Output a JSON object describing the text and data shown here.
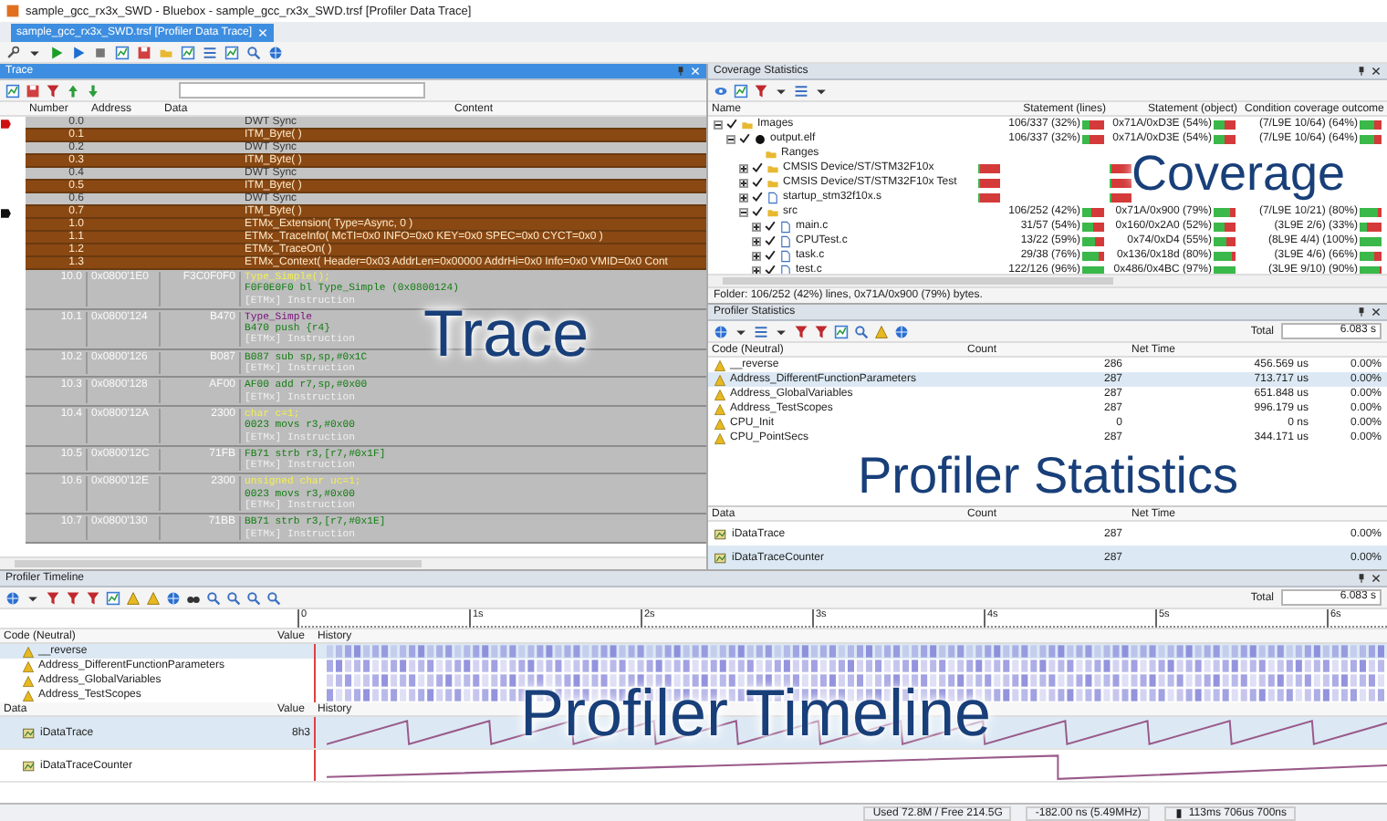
{
  "window": {
    "title": "sample_gcc_rx3x_SWD - Bluebox - sample_gcc_rx3x_SWD.trsf [Profiler Data Trace]"
  },
  "doc_tabs": [
    {
      "label": "sample_gcc_rx3x_SWD.trsf [Profiler Data Trace]",
      "selected": true
    }
  ],
  "trace": {
    "title": "Trace",
    "overlay": "Trace",
    "columns": [
      "Number",
      "Address",
      "Data",
      "Content"
    ],
    "header_rows": [
      {
        "number": "0.0",
        "content": "DWT Sync",
        "kind": "sync",
        "trigger": true,
        "cursor": false
      },
      {
        "number": "0.1",
        "content": "ITM_Byte( )",
        "kind": "event",
        "trigger": false,
        "cursor": false
      },
      {
        "number": "0.2",
        "content": "DWT Sync",
        "kind": "sync",
        "trigger": false,
        "cursor": false
      },
      {
        "number": "0.3",
        "content": "ITM_Byte( )",
        "kind": "event",
        "trigger": false,
        "cursor": false
      },
      {
        "number": "0.4",
        "content": "DWT Sync",
        "kind": "sync",
        "trigger": false,
        "cursor": false
      },
      {
        "number": "0.5",
        "content": "ITM_Byte( )",
        "kind": "event",
        "trigger": false,
        "cursor": false
      },
      {
        "number": "0.6",
        "content": "DWT Sync",
        "kind": "sync",
        "trigger": false,
        "cursor": false
      },
      {
        "number": "0.7",
        "content": "ITM_Byte( )",
        "kind": "event",
        "trigger": false,
        "cursor": true
      },
      {
        "number": "1.0",
        "content": "ETMx_Extension( Type=Async, 0 )",
        "kind": "event",
        "trigger": false,
        "cursor": false
      },
      {
        "number": "1.1",
        "content": "ETMx_TraceInfo( McTI=0x0 INFO=0x0 KEY=0x0 SPEC=0x0 CYCT=0x0 )",
        "kind": "event",
        "trigger": false,
        "cursor": false
      },
      {
        "number": "1.2",
        "content": "ETMx_TraceOn( )",
        "kind": "event",
        "trigger": false,
        "cursor": false
      },
      {
        "number": "1.3",
        "content": "ETMx_Context( Header=0x03 AddrLen=0x00000 AddrHi=0x0 Info=0x0 VMID=0x0 Cont",
        "kind": "event",
        "trigger": false,
        "cursor": false
      }
    ],
    "instruction_rows": [
      {
        "number": "10.0",
        "address": "0x0800'1E0",
        "data": "F3C0F0F0",
        "lines": [
          {
            "kind": "source",
            "text": "Type_Simple();"
          },
          {
            "kind": "asm",
            "text": "F0F0E0F0 bl          Type_Simple (0x0800124)"
          },
          {
            "kind": "note",
            "text": "[ETMx] Instruction"
          }
        ]
      },
      {
        "number": "10.1",
        "address": "0x0800'124",
        "data": "B470",
        "lines": [
          {
            "kind": "label",
            "text": "Type_Simple"
          },
          {
            "kind": "asm",
            "text": "B470 push    {r4}"
          },
          {
            "kind": "note",
            "text": "[ETMx] Instruction"
          }
        ]
      },
      {
        "number": "10.2",
        "address": "0x0800'126",
        "data": "B087",
        "lines": [
          {
            "kind": "asm",
            "text": "B087 sub     sp,sp,#0x1C"
          },
          {
            "kind": "note",
            "text": "[ETMx] Instruction"
          }
        ]
      },
      {
        "number": "10.3",
        "address": "0x0800'128",
        "data": "AF00",
        "lines": [
          {
            "kind": "asm",
            "text": "AF00 add     r7,sp,#0x00"
          },
          {
            "kind": "note",
            "text": "[ETMx] Instruction"
          }
        ]
      },
      {
        "number": "10.4",
        "address": "0x0800'12A",
        "data": "2300",
        "lines": [
          {
            "kind": "source",
            "text": "char c=1;"
          },
          {
            "kind": "asm",
            "text": "0023 movs    r3,#0x00"
          },
          {
            "kind": "note",
            "text": "[ETMx] Instruction"
          }
        ]
      },
      {
        "number": "10.5",
        "address": "0x0800'12C",
        "data": "71FB",
        "lines": [
          {
            "kind": "asm",
            "text": "FB71 strb    r3,[r7,#0x1F]"
          },
          {
            "kind": "note",
            "text": "[ETMx] Instruction"
          }
        ]
      },
      {
        "number": "10.6",
        "address": "0x0800'12E",
        "data": "2300",
        "lines": [
          {
            "kind": "source",
            "text": "unsigned char uc=1;"
          },
          {
            "kind": "asm",
            "text": "0023 movs    r3,#0x00"
          },
          {
            "kind": "note",
            "text": "[ETMx] Instruction"
          }
        ]
      },
      {
        "number": "10.7",
        "address": "0x0800'130",
        "data": "71BB",
        "lines": [
          {
            "kind": "asm",
            "text": "BB71 strb    r3,[r7,#0x1E]"
          },
          {
            "kind": "note",
            "text": "[ETMx] Instruction"
          }
        ]
      }
    ]
  },
  "coverage": {
    "title": "Coverage Statistics",
    "overlay": "Coverage",
    "name_column": "Name",
    "columns": [
      "Statement (lines)",
      "Statement (object)",
      "Condition coverage outcome"
    ],
    "rows": [
      {
        "name": "Images",
        "kind": "folder",
        "checked": true,
        "expanded": true,
        "cells": [
          {
            "text": "106/337 (32%)",
            "level": 0.32
          },
          {
            "text": "0x71A/0xD3E (54%)",
            "level": 0.54
          },
          {
            "text": "(7/L9E 10/64) (64%)",
            "level": 0.64
          }
        ],
        "children": [
          {
            "name": "output.elf",
            "kind": "elf",
            "checked": true,
            "expanded": true,
            "cells": [
              {
                "text": "106/337 (32%)",
                "level": 0.32
              },
              {
                "text": "0x71A/0xD3E (54%)",
                "level": 0.54
              },
              {
                "text": "(7/L9E 10/64) (64%)",
                "level": 0.64
              }
            ],
            "children": [
              {
                "name": "Ranges",
                "kind": "folder"
              },
              {
                "name": "CMSIS Device/ST/STM32F10x",
                "kind": "folder",
                "checked": true,
                "expanded": false,
                "cells": [
                  {
                    "level": 0
                  },
                  {
                    "level": 0
                  }
                ]
              },
              {
                "name": "CMSIS Device/ST/STM32F10x Test",
                "kind": "folder",
                "checked": true,
                "expanded": false,
                "cells": [
                  {
                    "level": 0
                  },
                  {
                    "level": 0
                  }
                ]
              },
              {
                "name": "startup_stm32f10x.s",
                "kind": "file",
                "checked": true,
                "expanded": false,
                "cells": [
                  {
                    "level": 0
                  },
                  {
                    "level": 0
                  }
                ]
              },
              {
                "name": "src",
                "kind": "folder",
                "checked": true,
                "expanded": true,
                "cells": [
                  {
                    "text": "106/252 (42%)",
                    "level": 0.42
                  },
                  {
                    "text": "0x71A/0x900 (79%)",
                    "level": 0.79
                  },
                  {
                    "text": "(7/L9E 10/21) (80%)",
                    "level": 0.8
                  }
                ],
                "children": [
                  {
                    "name": "main.c",
                    "kind": "file",
                    "checked": true,
                    "expanded": false,
                    "cells": [
                      {
                        "text": "31/57 (54%)",
                        "level": 0.54
                      },
                      {
                        "text": "0x160/0x2A0 (52%)",
                        "level": 0.52
                      },
                      {
                        "text": "(3L9E 2/6) (33%)",
                        "level": 0.33
                      }
                    ]
                  },
                  {
                    "name": "CPUTest.c",
                    "kind": "file",
                    "checked": true,
                    "expanded": false,
                    "cells": [
                      {
                        "text": "13/22 (59%)",
                        "level": 0.59
                      },
                      {
                        "text": "0x74/0xD4 (55%)",
                        "level": 0.55
                      },
                      {
                        "text": "(8L9E 4/4) (100%)",
                        "level": 1
                      }
                    ]
                  },
                  {
                    "name": "task.c",
                    "kind": "file",
                    "checked": true,
                    "expanded": false,
                    "cells": [
                      {
                        "text": "29/38 (76%)",
                        "level": 0.76
                      },
                      {
                        "text": "0x136/0x18d (80%)",
                        "level": 0.8
                      },
                      {
                        "text": "(3L9E 4/6) (66%)",
                        "level": 0.66
                      }
                    ]
                  },
                  {
                    "name": "test.c",
                    "kind": "file",
                    "checked": true,
                    "expanded": false,
                    "cells": [
                      {
                        "text": "122/126 (96%)",
                        "level": 0.96
                      },
                      {
                        "text": "0x486/0x4BC (97%)",
                        "level": 0.97
                      },
                      {
                        "text": "(3L9E 9/10) (90%)",
                        "level": 0.9
                      }
                    ]
                  }
                ]
              }
            ]
          }
        ]
      }
    ],
    "footer": "Folder: 106/252 (42%) lines, 0x71A/0x900 (79%) bytes."
  },
  "profiler_statistics": {
    "title": "Profiler Statistics",
    "overlay": "Profiler Statistics",
    "total_label": "Total",
    "total": "6.083 s",
    "columns": [
      "Code (Neutral)",
      "Count",
      "Net Time"
    ],
    "rows": [
      {
        "name": "__reverse",
        "count": "286",
        "net_time": "456.569 us",
        "percent": "0.00%",
        "selected": false
      },
      {
        "name": "Address_DifferentFunctionParameters",
        "count": "287",
        "net_time": "713.717 us",
        "percent": "0.00%",
        "selected": true
      },
      {
        "name": "Address_GlobalVariables",
        "count": "287",
        "net_time": "651.848 us",
        "percent": "0.00%",
        "selected": false
      },
      {
        "name": "Address_TestScopes",
        "count": "287",
        "net_time": "996.179 us",
        "percent": "0.00%",
        "selected": false
      },
      {
        "name": "CPU_Init",
        "count": "0",
        "net_time": "0 ns",
        "percent": "0.00%",
        "selected": false
      },
      {
        "name": "CPU_PointSecs",
        "count": "287",
        "net_time": "344.171 us",
        "percent": "0.00%",
        "selected": false
      }
    ],
    "data_columns": [
      "Data",
      "Count",
      "Net Time"
    ],
    "data_rows": [
      {
        "name": "iDataTrace",
        "count": "287",
        "percent": "0.00%",
        "selected": false
      },
      {
        "name": "iDataTraceCounter",
        "count": "287",
        "percent": "0.00%",
        "selected": true
      }
    ]
  },
  "profiler_timeline": {
    "title": "Profiler Timeline",
    "overlay": "Profiler Timeline",
    "total_label": "Total",
    "total": "6.083 s",
    "ticks": [
      "0",
      "1s",
      "2s",
      "3s",
      "4s",
      "5s",
      "6s"
    ],
    "code_columns": [
      "Code (Neutral)",
      "Value",
      "History"
    ],
    "code_rows": [
      {
        "name": "__reverse",
        "selected": true
      },
      {
        "name": "Address_DifferentFunctionParameters",
        "selected": false
      },
      {
        "name": "Address_GlobalVariables",
        "selected": false
      },
      {
        "name": "Address_TestScopes",
        "selected": false
      }
    ],
    "data_columns": [
      "Data",
      "Value",
      "History"
    ],
    "data_rows": [
      {
        "name": "iDataTrace",
        "value": "8h3",
        "selected": true,
        "kind": "sawtooth"
      },
      {
        "name": "iDataTraceCounter",
        "selected": false,
        "kind": "ramp"
      }
    ]
  },
  "status_bar": [
    "Used 72.8M / Free 214.5G",
    "-182.00 ns (5.49MHz)",
    "113ms 706us 700ns"
  ]
}
